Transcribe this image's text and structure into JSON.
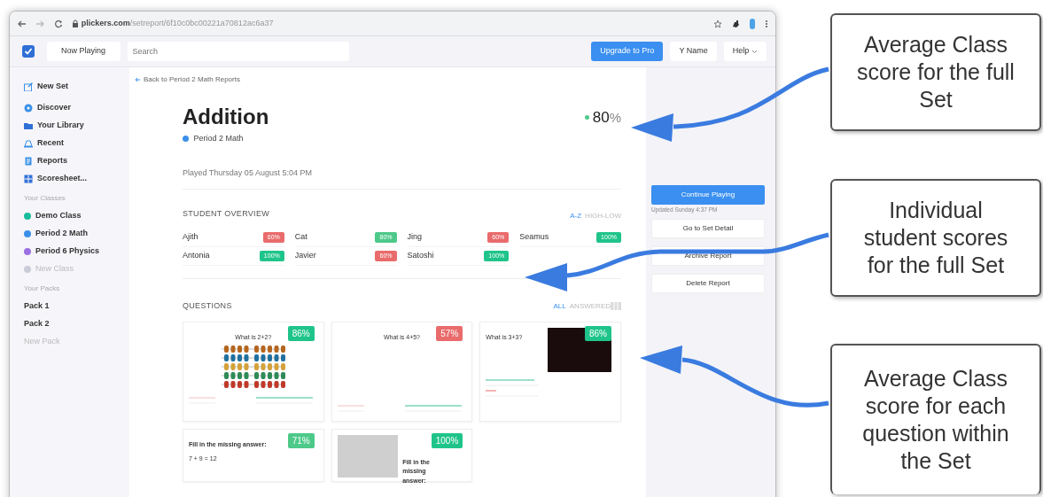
{
  "browser": {
    "url_domain": "plickers.com",
    "url_path": "/setreport/6f10c0bc00221a70812ac6a37"
  },
  "header": {
    "now_playing": "Now Playing",
    "search_placeholder": "Search",
    "upgrade": "Upgrade to Pro",
    "user": "Y Name",
    "help": "Help"
  },
  "sidebar": {
    "items": [
      {
        "label": "New Set"
      },
      {
        "label": "Discover"
      },
      {
        "label": "Your Library"
      },
      {
        "label": "Recent"
      },
      {
        "label": "Reports"
      },
      {
        "label": "Scoresheet..."
      }
    ],
    "classes_heading": "Your Classes",
    "classes": [
      {
        "label": "Demo Class",
        "color": "#1bbc9b",
        "disabled": false
      },
      {
        "label": "Period 2 Math",
        "color": "#3a8fe8",
        "disabled": false
      },
      {
        "label": "Period 6 Physics",
        "color": "#9b6fe0",
        "disabled": false
      },
      {
        "label": "New Class",
        "color": "#c9ccd8",
        "disabled": true
      }
    ],
    "packs_heading": "Your Packs",
    "packs": [
      {
        "label": "Pack 1",
        "disabled": false
      },
      {
        "label": "Pack 2",
        "disabled": false
      },
      {
        "label": "New Pack",
        "disabled": true
      }
    ]
  },
  "report": {
    "back": "Back to Period 2 Math Reports",
    "title": "Addition",
    "class_name": "Period 2 Math",
    "score": "80",
    "score_unit": "%",
    "played": "Played Thursday 05 August 5:04 PM",
    "student_overview": {
      "heading": "STUDENT OVERVIEW",
      "sorts": [
        {
          "label": "A-Z",
          "selected": true
        },
        {
          "label": "HIGH-LOW",
          "selected": false
        }
      ],
      "students": [
        {
          "name": "Ajith",
          "score": "60%",
          "color": "#e96b6b"
        },
        {
          "name": "Cat",
          "score": "80%",
          "color": "#4dc98a"
        },
        {
          "name": "Jing",
          "score": "60%",
          "color": "#e96b6b"
        },
        {
          "name": "Seamus",
          "score": "100%",
          "color": "#1fc48a"
        },
        {
          "name": "Antonia",
          "score": "100%",
          "color": "#1fc48a"
        },
        {
          "name": "Javier",
          "score": "60%",
          "color": "#e96b6b"
        },
        {
          "name": "Satoshi",
          "score": "100%",
          "color": "#1fc48a"
        }
      ]
    },
    "questions": {
      "heading": "QUESTIONS",
      "filters": [
        {
          "label": "ALL",
          "selected": true
        },
        {
          "label": "ANSWERED",
          "selected": false
        }
      ],
      "cards": [
        {
          "kind": "abacus",
          "title": "What is 2+2?",
          "score": "86%",
          "color": "#1fc48a"
        },
        {
          "kind": "plain",
          "title": "What is 4+5?",
          "score": "57%",
          "color": "#e96b6b"
        },
        {
          "kind": "photo",
          "title": "What is 3+3?",
          "score": "86%",
          "color": "#1fc48a"
        },
        {
          "kind": "fill",
          "title": "Fill in the missing answer:",
          "body": "7 + 9 = 12",
          "score": "71%",
          "color": "#4dc98a"
        },
        {
          "kind": "picture",
          "title": "Fill in the missing answer:",
          "score": "100%",
          "color": "#1fc48a"
        }
      ]
    }
  },
  "panel": {
    "continue": "Continue Playing",
    "updated": "Updated Sunday 4:37 PM",
    "buttons": [
      "Go to Set Detail",
      "Archive Report",
      "Delete Report"
    ]
  },
  "callouts": [
    "Average Class score for the full Set",
    "Individual student scores for the full Set",
    "Average Class score for each question within the Set"
  ]
}
